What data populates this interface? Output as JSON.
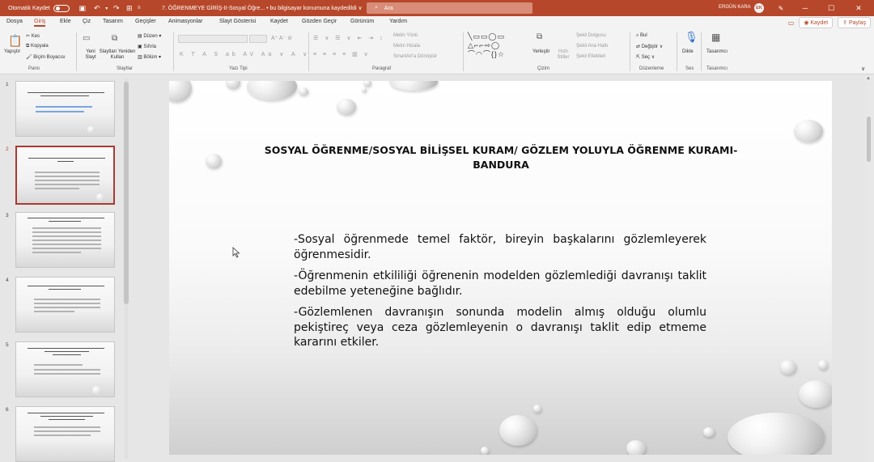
{
  "titlebar": {
    "autosave_label": "Otomatik Kaydet",
    "doc_title": "7. ÖĞRENMEYE GİRİŞ-II-Sosyal Öğre...  •  bu bilgisayar konumuna kaydedildi  ∨",
    "search_placeholder": "Ara",
    "user_name": "ERGÜN KARA",
    "user_initials": "EK"
  },
  "menu": {
    "tabs": [
      "Dosya",
      "Giriş",
      "Ekle",
      "Çiz",
      "Tasarım",
      "Geçişler",
      "Animasyonlar",
      "Slayt Gösterisi",
      "Kaydet",
      "Gözden Geçir",
      "Görünüm",
      "Yardım"
    ],
    "active_tab": "Giriş",
    "record_button": "Kaydet",
    "share_button": "Paylaş"
  },
  "ribbon": {
    "clipboard": {
      "paste": "Yapıştır",
      "cut": "Kes",
      "copy": "Kopyala",
      "format_painter": "Biçim Boyacısı",
      "group": "Pano"
    },
    "slides": {
      "new_slide": "Yeni Slayt",
      "reuse": "Slaytları Yeniden Kullan",
      "layout": "Düzen",
      "reset": "Sıfırla",
      "section": "Bölüm",
      "group": "Slaytlar"
    },
    "font": {
      "group": "Yazı Tipi",
      "bold": "K",
      "italic": "T",
      "underline": "A",
      "strike": "S",
      "grow": "A⁺",
      "shrink": "A⁻"
    },
    "paragraph": {
      "text_direction": "Metin Yönü",
      "align_text": "Metni Hizala",
      "smartart": "SmartArt'a Dönüştür",
      "group": "Paragraf"
    },
    "drawing": {
      "arrange": "Yerleştir",
      "quick_styles": "Hızlı Stiller",
      "fill": "Şekil Dolgusu",
      "outline": "Şekil Ana Hattı",
      "effects": "Şekil Efektleri",
      "group": "Çizim"
    },
    "editing": {
      "find": "Bul",
      "replace": "Değiştir",
      "select": "Seç",
      "group": "Düzenleme"
    },
    "voice": {
      "dictate": "Dikte",
      "group": "Ses"
    },
    "designer": {
      "label": "Tasarımcı",
      "group": "Tasarımcı"
    }
  },
  "thumbnails": {
    "numbers": [
      "1",
      "2",
      "3",
      "4",
      "5",
      "6"
    ],
    "selected": "2"
  },
  "slide": {
    "title_line1": "SOSYAL ÖĞRENME/SOSYAL BİLİŞSEL KURAM/ GÖZLEM YOLUYLA ÖĞRENME KURAMI-",
    "title_line2": "BANDURA",
    "bullets": [
      "-Sosyal öğrenmede temel faktör, bireyin başkalarını gözlemleyerek öğrenmesidir.",
      "-Öğrenmenin etkililiği öğrenenin modelden gözlemlediği davranışı taklit edebilme yeteneğine bağlıdır.",
      "-Gözlemlenen davranışın sonunda modelin almış olduğu olumlu pekiştireç veya ceza gözlemleyenin o davranışı taklit edip etmeme kararını etkiler."
    ]
  },
  "colors": {
    "accent": "#b7472a",
    "selected_thumb_border": "#a83a33"
  },
  "icons": [
    "save-icon",
    "undo-icon",
    "redo-icon",
    "present-icon",
    "search-icon",
    "pen-icon",
    "minimize-icon",
    "maximize-icon",
    "close-icon",
    "microphone-icon",
    "designer-icon"
  ]
}
